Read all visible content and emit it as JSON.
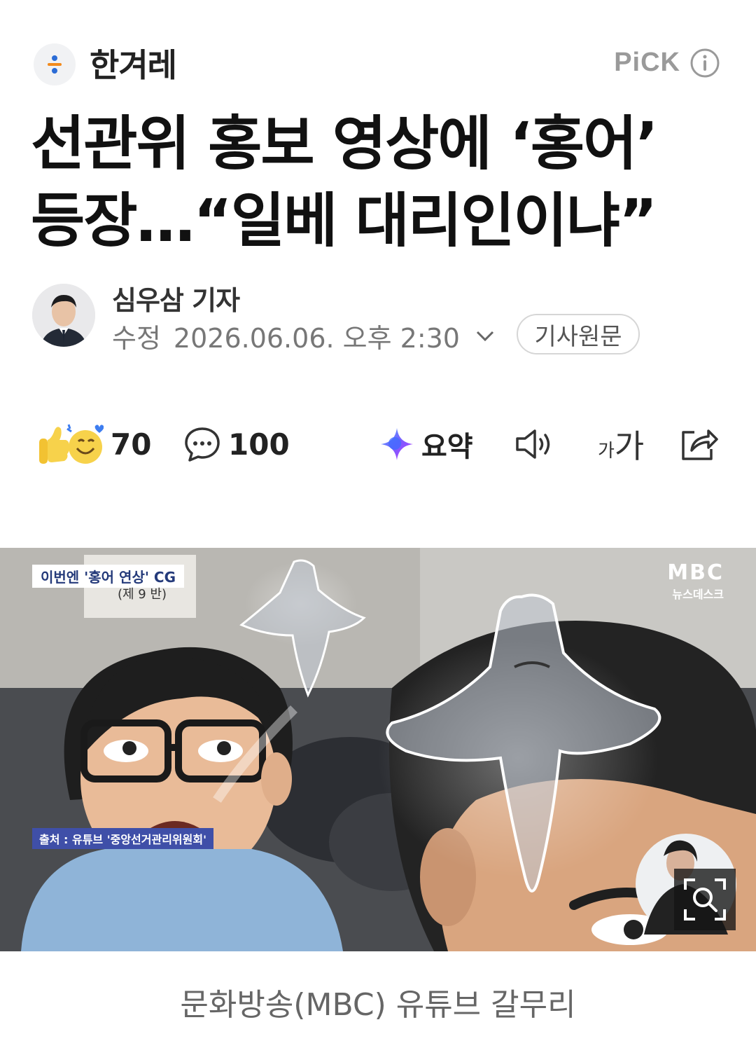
{
  "header": {
    "press_name": "한겨레",
    "pick_label": "PiCK"
  },
  "article": {
    "headline_line1": "선관위 홍보 영상에 ‘홍어’",
    "headline_line2": "등장…“일베 대리인이냐”",
    "reporter": "심우삼 기자",
    "date_prefix": "수정",
    "date": "2026.06.06. 오후 2:30",
    "original_button": "기사원문"
  },
  "toolbar": {
    "reaction_count": "70",
    "comment_count": "100",
    "summary_label": "요약",
    "font_label_small": "가",
    "font_label_large": "가"
  },
  "photo": {
    "top_label": "이번엔 '홍어 연상' CG",
    "sub_label": "(제 9 반)",
    "source_label": "출처 : 유튜브 '중앙선거관리위원회'",
    "broadcaster": "MBC",
    "broadcaster_sub": "뉴스데스크"
  },
  "caption": "문화방송(MBC) 유튜브 갈무리"
}
